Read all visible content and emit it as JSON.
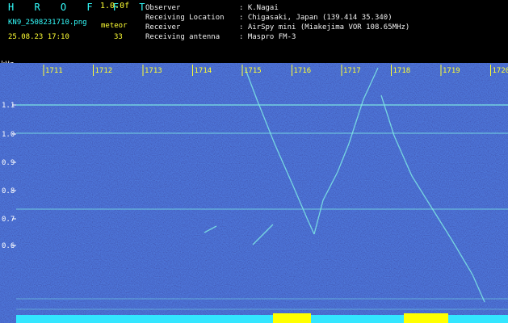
{
  "header": {
    "brand": "H R O F F T",
    "version": "1.0.0f",
    "filename": "KN9_2508231710.png",
    "datetime": "25.08.23 17:10",
    "meteor_label": "meteor",
    "meteor_count": "33"
  },
  "info": {
    "observer_label": "Observer",
    "observer_value": ": K.Nagai",
    "location_label": "Receiving Location",
    "location_value": ": Chigasaki, Japan (139.414 35.340)",
    "receiver_label": "Receiver",
    "receiver_value": ": AirSpy mini (Miakejima VOR 108.65MHz)",
    "antenna_label": "Receiving antenna",
    "antenna_value": ": Maspro FM-3"
  },
  "chart_data": {
    "type": "heatmap",
    "ylabel": "kHz",
    "yticks": [
      "1.1",
      "1.0",
      "0.9",
      "0.8",
      "0.7",
      "0.6"
    ],
    "xticks": [
      "1711",
      "1712",
      "1713",
      "1714",
      "1715",
      "1716",
      "1717",
      "1718",
      "1719",
      "1720"
    ],
    "grid": false,
    "colors": {
      "background": "#2a36a6",
      "trace": "#7fe9e4",
      "marker": "#ffff33",
      "baseline": "#33e6ff",
      "burst": "#ffff00"
    }
  }
}
